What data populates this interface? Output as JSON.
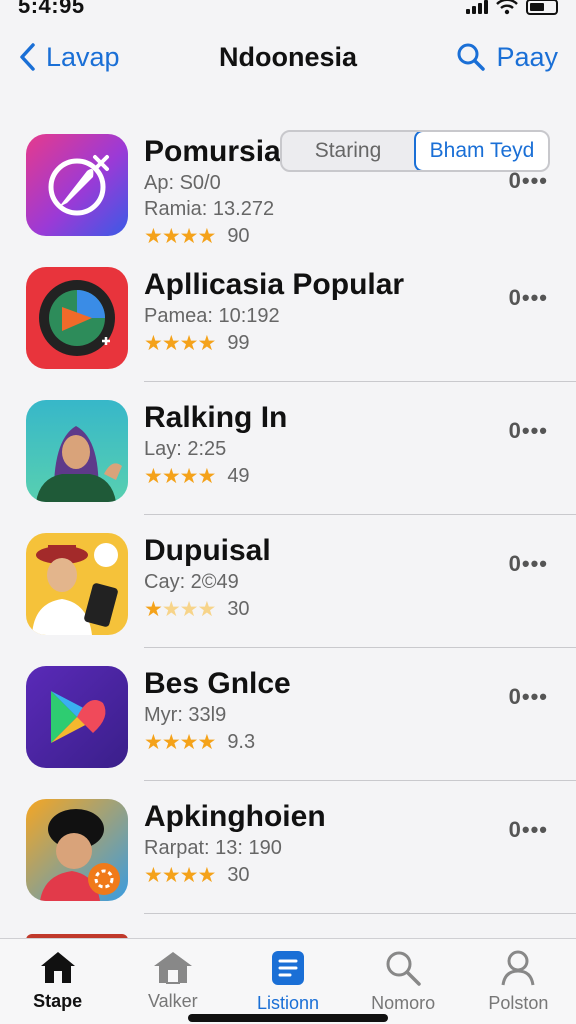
{
  "status_bar": {
    "time": "5:4:95"
  },
  "nav": {
    "back_label": "Lavap",
    "title": "Ndoonesia",
    "right_label": "Paay"
  },
  "segment": {
    "options": [
      "Staring",
      "Bham Teyd"
    ],
    "selected": "Bham Teyd"
  },
  "apps": [
    {
      "name": "Pomursia",
      "sub1": "Ap: S0/0",
      "sub2": "Ramia: 13.272",
      "rating_count": "90",
      "stars": 4,
      "more": "0•••"
    },
    {
      "name": "Apllicasia Popular",
      "sub1": "Pamea: 10:192",
      "rating_count": "99",
      "stars": 4,
      "more": "0•••"
    },
    {
      "name": "Ralking In",
      "sub1": "Lay: 2:25",
      "rating_count": "49",
      "stars": 4,
      "more": "0•••"
    },
    {
      "name": "Dupuisal",
      "sub1": "Cay: 2©49",
      "rating_count": "30",
      "stars": 1.5,
      "more": "0•••"
    },
    {
      "name": "Bes Gnlce",
      "sub1": "Myr: 33l9",
      "rating_count": "9.3",
      "stars": 4,
      "more": "0•••"
    },
    {
      "name": "Apkinghoien",
      "sub1": "Rarpat: 13: 190",
      "rating_count": "30",
      "stars": 4,
      "more": "0•••"
    }
  ],
  "tabs": [
    {
      "label": "Stape",
      "icon": "home-icon"
    },
    {
      "label": "Valker",
      "icon": "house-outline-icon"
    },
    {
      "label": "Listionn",
      "icon": "list-icon"
    },
    {
      "label": "Nomoro",
      "icon": "search-icon"
    },
    {
      "label": "Polston",
      "icon": "person-icon"
    }
  ],
  "colors": {
    "accent": "#1a6fd6",
    "star": "#f4a21a"
  }
}
